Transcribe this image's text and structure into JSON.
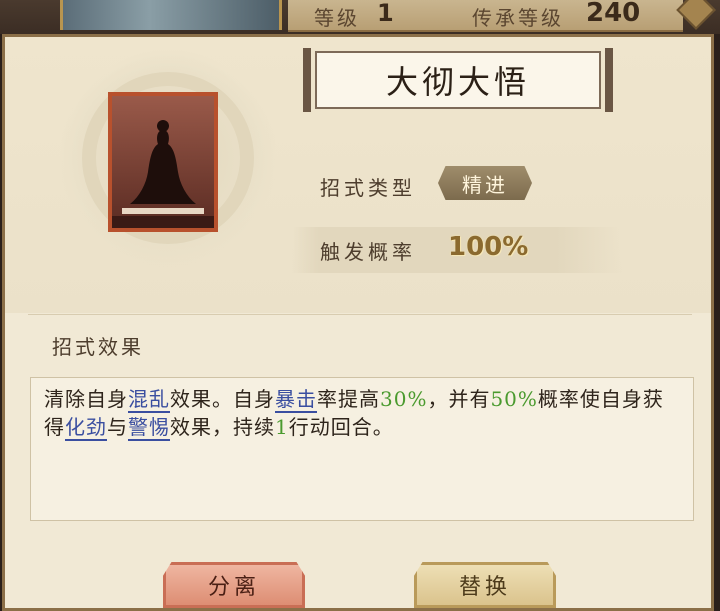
{
  "header": {
    "level_label": "等级",
    "level_value": "1",
    "inherit_label": "传承等级",
    "inherit_value": "240"
  },
  "skill": {
    "name": "大彻大悟",
    "type_label": "招式类型",
    "type_value": "精进",
    "trigger_label": "触发概率",
    "trigger_value": "100%",
    "effect_heading": "招式效果",
    "effect": {
      "p1": "清除自身",
      "kw1": "混乱",
      "p2": "效果。自身",
      "kw2": "暴击",
      "p3": "率提高",
      "n1": "30%",
      "p4": "，并有",
      "n2": "50%",
      "p5": "概率使自身获得",
      "kw3": "化劲",
      "p6": "与",
      "kw4": "警惕",
      "p7": "效果，持续",
      "n3": "1",
      "p8": "行动回合。"
    }
  },
  "buttons": {
    "separate": "分离",
    "replace": "替换"
  },
  "colors": {
    "keyword": "#3a4ea0",
    "number": "#4a9a2e",
    "panel_bg": "#f1e9d5"
  }
}
